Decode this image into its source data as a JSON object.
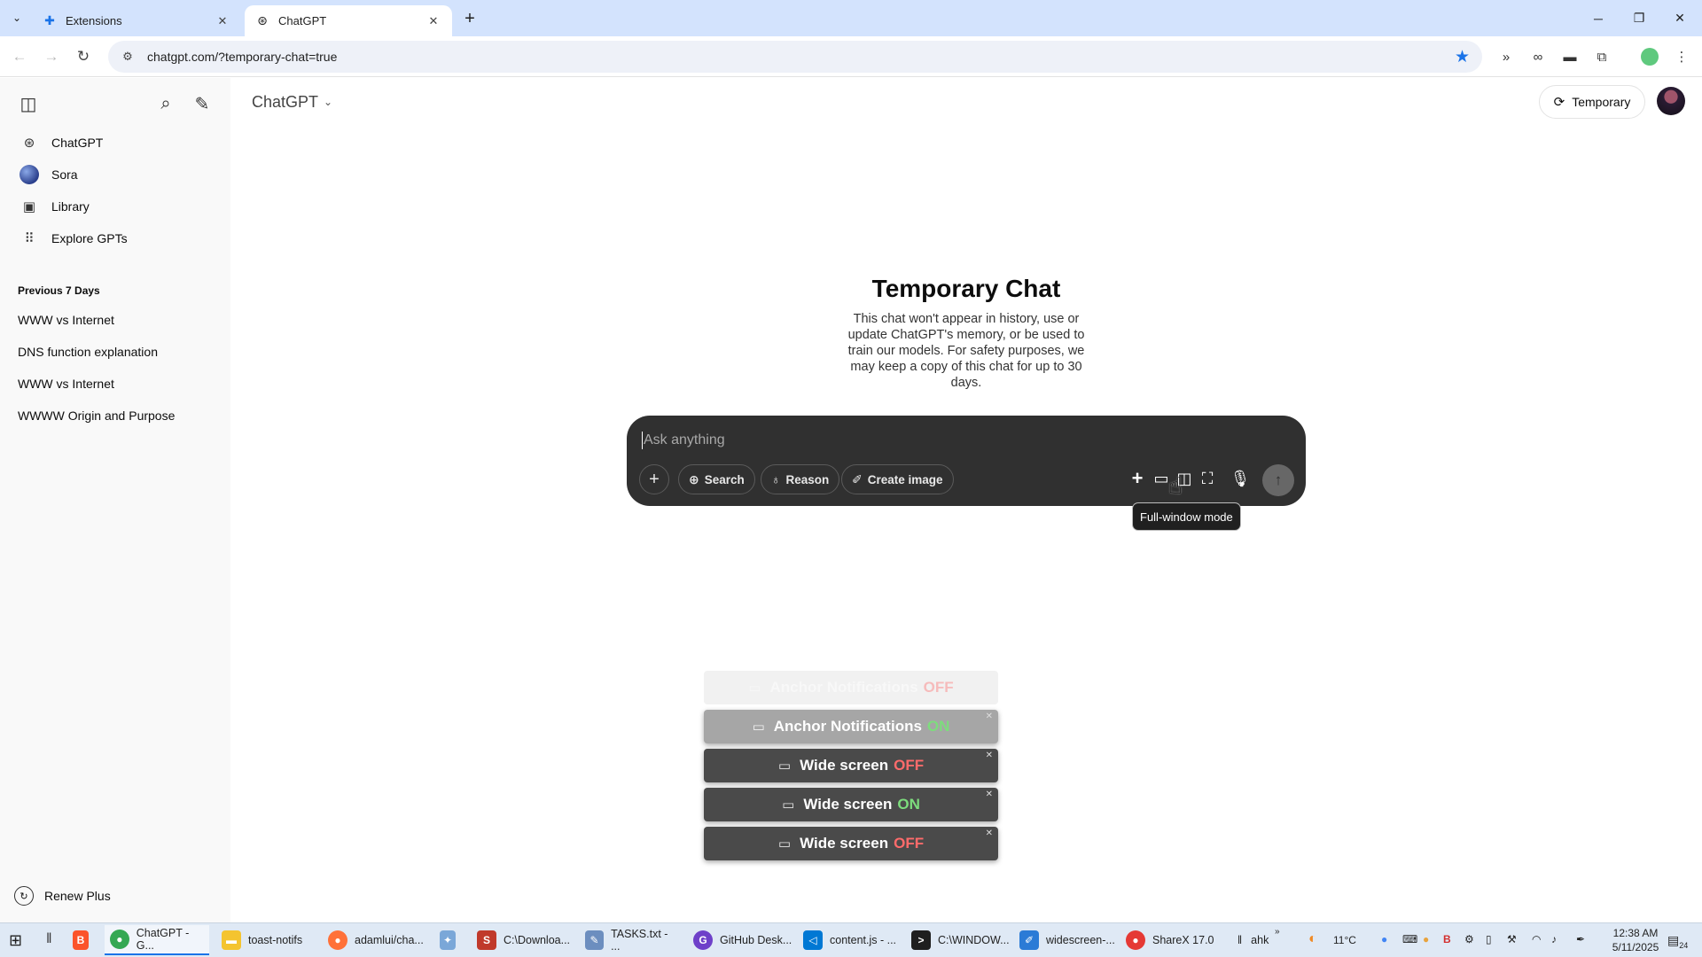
{
  "browser": {
    "tabs": [
      {
        "label": "Extensions",
        "icon": "puzzle-icon"
      },
      {
        "label": "ChatGPT",
        "icon": "openai-icon"
      }
    ],
    "url": "chatgpt.com/?temporary-chat=true"
  },
  "sidebar": {
    "nav": [
      {
        "label": "ChatGPT",
        "icon": "openai-icon"
      },
      {
        "label": "Sora",
        "icon": "sora-icon"
      },
      {
        "label": "Library",
        "icon": "library-icon"
      },
      {
        "label": "Explore GPTs",
        "icon": "grid-icon"
      }
    ],
    "section_title": "Previous 7 Days",
    "history": [
      "WWW vs Internet",
      "DNS function explanation",
      "WWW vs Internet",
      "WWWW Origin and Purpose"
    ],
    "renew_label": "Renew Plus"
  },
  "header": {
    "model": "ChatGPT",
    "temporary_label": "Temporary"
  },
  "hero": {
    "title": "Temporary Chat",
    "body": "This chat won't appear in history, use or update ChatGPT's memory, or be used to train our models. For safety purposes, we may keep a copy of this chat for up to 30 days."
  },
  "composer": {
    "placeholder": "Ask anything",
    "buttons": [
      "Search",
      "Reason",
      "Create image"
    ],
    "tooltip": "Full-window mode"
  },
  "toasts": [
    {
      "text": "Anchor Notifications",
      "status": "OFF",
      "status_color": "#ff6b6b",
      "faded": true
    },
    {
      "text": "Anchor Notifications",
      "status": "ON",
      "status_color": "#7ddc7d"
    },
    {
      "text": "Wide screen",
      "status": "OFF",
      "status_color": "#ff6b6b"
    },
    {
      "text": "Wide screen",
      "status": "ON",
      "status_color": "#7ddc7d"
    },
    {
      "text": "Wide screen",
      "status": "OFF",
      "status_color": "#ff6b6b"
    }
  ],
  "taskbar": {
    "items": [
      "ChatGPT - G...",
      "toast-notifs",
      "adamlui/cha...",
      "C:\\Downloa...",
      "TASKS.txt - ...",
      "GitHub Desk...",
      "content.js - ...",
      "C:\\WINDOW...",
      "widescreen-...",
      "ShareX 17.0",
      "ahk"
    ],
    "weather": "11°C",
    "time": "12:38 AM",
    "date": "5/11/2025",
    "notif_count": "24"
  },
  "colors": {
    "tabstrip": "#d3e3fd",
    "composer": "#303030",
    "sidebar": "#f9f9f9",
    "bookmark_star": "#1a73e8"
  }
}
